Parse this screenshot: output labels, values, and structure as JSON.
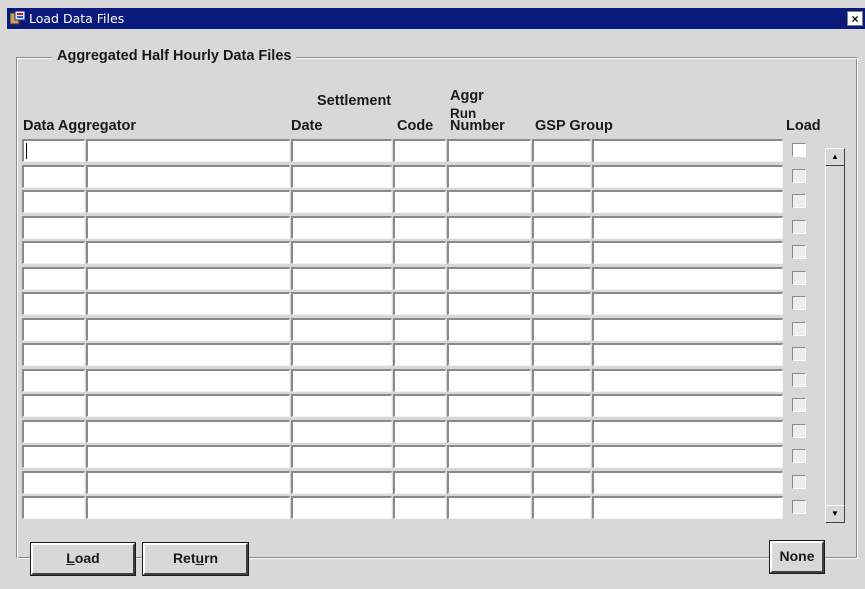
{
  "window": {
    "title": "Load Data Files",
    "close_symbol": "×"
  },
  "group": {
    "title": "Aggregated Half Hourly Data Files"
  },
  "headers": {
    "data_aggregator": "Data Aggregator",
    "settlement": "Settlement",
    "date": "Date",
    "code": "Code",
    "aggr": "Aggr",
    "run": "Run",
    "number": "Number",
    "gsp_group": "GSP Group",
    "load": "Load"
  },
  "rows": [
    {
      "data_aggregator_id": "",
      "data_aggregator_name": "",
      "settlement_date": "",
      "settlement_code": "",
      "aggr_run_number": "",
      "gsp_group_id": "",
      "gsp_group_name": "",
      "load": false
    },
    {
      "data_aggregator_id": "",
      "data_aggregator_name": "",
      "settlement_date": "",
      "settlement_code": "",
      "aggr_run_number": "",
      "gsp_group_id": "",
      "gsp_group_name": "",
      "load": false
    },
    {
      "data_aggregator_id": "",
      "data_aggregator_name": "",
      "settlement_date": "",
      "settlement_code": "",
      "aggr_run_number": "",
      "gsp_group_id": "",
      "gsp_group_name": "",
      "load": false
    },
    {
      "data_aggregator_id": "",
      "data_aggregator_name": "",
      "settlement_date": "",
      "settlement_code": "",
      "aggr_run_number": "",
      "gsp_group_id": "",
      "gsp_group_name": "",
      "load": false
    },
    {
      "data_aggregator_id": "",
      "data_aggregator_name": "",
      "settlement_date": "",
      "settlement_code": "",
      "aggr_run_number": "",
      "gsp_group_id": "",
      "gsp_group_name": "",
      "load": false
    },
    {
      "data_aggregator_id": "",
      "data_aggregator_name": "",
      "settlement_date": "",
      "settlement_code": "",
      "aggr_run_number": "",
      "gsp_group_id": "",
      "gsp_group_name": "",
      "load": false
    },
    {
      "data_aggregator_id": "",
      "data_aggregator_name": "",
      "settlement_date": "",
      "settlement_code": "",
      "aggr_run_number": "",
      "gsp_group_id": "",
      "gsp_group_name": "",
      "load": false
    },
    {
      "data_aggregator_id": "",
      "data_aggregator_name": "",
      "settlement_date": "",
      "settlement_code": "",
      "aggr_run_number": "",
      "gsp_group_id": "",
      "gsp_group_name": "",
      "load": false
    },
    {
      "data_aggregator_id": "",
      "data_aggregator_name": "",
      "settlement_date": "",
      "settlement_code": "",
      "aggr_run_number": "",
      "gsp_group_id": "",
      "gsp_group_name": "",
      "load": false
    },
    {
      "data_aggregator_id": "",
      "data_aggregator_name": "",
      "settlement_date": "",
      "settlement_code": "",
      "aggr_run_number": "",
      "gsp_group_id": "",
      "gsp_group_name": "",
      "load": false
    },
    {
      "data_aggregator_id": "",
      "data_aggregator_name": "",
      "settlement_date": "",
      "settlement_code": "",
      "aggr_run_number": "",
      "gsp_group_id": "",
      "gsp_group_name": "",
      "load": false
    },
    {
      "data_aggregator_id": "",
      "data_aggregator_name": "",
      "settlement_date": "",
      "settlement_code": "",
      "aggr_run_number": "",
      "gsp_group_id": "",
      "gsp_group_name": "",
      "load": false
    },
    {
      "data_aggregator_id": "",
      "data_aggregator_name": "",
      "settlement_date": "",
      "settlement_code": "",
      "aggr_run_number": "",
      "gsp_group_id": "",
      "gsp_group_name": "",
      "load": false
    },
    {
      "data_aggregator_id": "",
      "data_aggregator_name": "",
      "settlement_date": "",
      "settlement_code": "",
      "aggr_run_number": "",
      "gsp_group_id": "",
      "gsp_group_name": "",
      "load": false
    },
    {
      "data_aggregator_id": "",
      "data_aggregator_name": "",
      "settlement_date": "",
      "settlement_code": "",
      "aggr_run_number": "",
      "gsp_group_id": "",
      "gsp_group_name": "",
      "load": false
    }
  ],
  "scrollbar": {
    "up_symbol": "▲",
    "down_symbol": "▼"
  },
  "buttons": {
    "load": {
      "mnemonic": "L",
      "rest": "oad"
    },
    "return": {
      "before": "Ret",
      "mnemonic": "u",
      "after": "rn"
    },
    "none": {
      "label": "None"
    }
  },
  "icons": {
    "app": "forms-app-icon",
    "close": "close-icon",
    "up": "scroll-up-icon",
    "down": "scroll-down-icon"
  },
  "colors": {
    "titlebar": "#0a1a7a",
    "face": "#d8d8d8",
    "field": "#ffffff"
  }
}
